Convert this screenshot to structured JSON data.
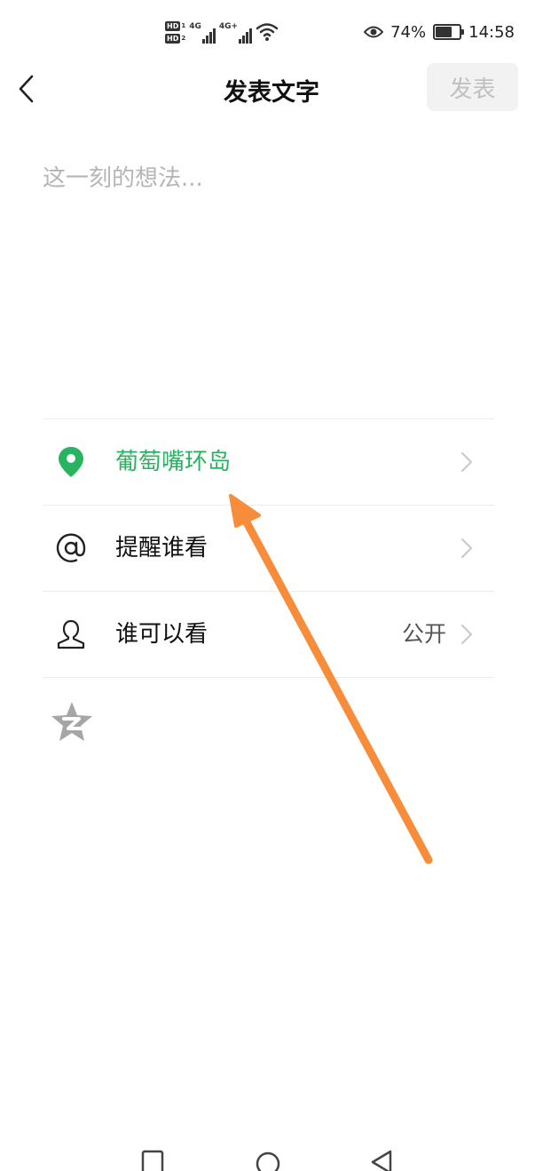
{
  "status_bar": {
    "hd1_label": "HD",
    "hd1_num": "1",
    "hd2_label": "HD",
    "hd2_num": "2",
    "network1": "4G",
    "network2": "4G+",
    "battery_percent_text": "74%",
    "battery_level": 0.74,
    "time": "14:58",
    "icons": [
      "eye-icon",
      "wifi-icon",
      "signal-icon",
      "battery-icon"
    ]
  },
  "header": {
    "title": "发表文字",
    "publish_label": "发表",
    "back_icon": "back-chevron-icon"
  },
  "composer": {
    "placeholder": "这一刻的想法..."
  },
  "options": {
    "location": {
      "label": "葡萄嘴环岛",
      "icon": "location-pin-icon"
    },
    "mention": {
      "label": "提醒谁看",
      "icon": "at-icon"
    },
    "visibility": {
      "label": "谁可以看",
      "value": "公开",
      "icon": "person-icon"
    }
  },
  "qzone": {
    "icon": "qzone-star-icon"
  },
  "nav": {
    "icons": [
      "recent-apps-icon",
      "home-icon",
      "back-icon"
    ]
  },
  "colors": {
    "accent_green": "#27b35f",
    "annotation_orange": "#f78c3a",
    "divider": "#ececec",
    "placeholder": "#b5b5b5"
  }
}
